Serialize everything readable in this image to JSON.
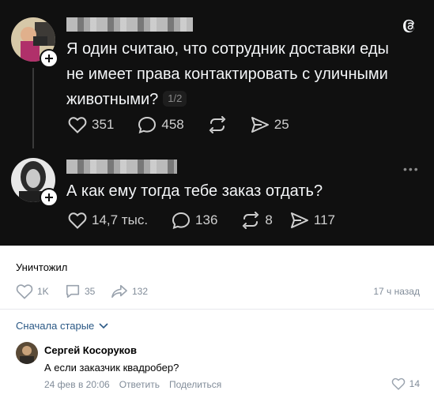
{
  "threads": {
    "post1": {
      "text_line1": "Я один считаю, что сотрудник доставки еды",
      "text_line2": "не имеет права контактировать с уличными",
      "text_line3": "животными?",
      "page": "1/2",
      "likes": "351",
      "comments": "458",
      "shares": "25"
    },
    "post2": {
      "text": "А как ему тогда тебе заказ отдать?",
      "likes": "14,7 тыс.",
      "comments": "136",
      "reposts": "8",
      "shares": "117"
    }
  },
  "vk_post": {
    "caption": "Уничтожил",
    "likes": "1K",
    "comments": "35",
    "shares": "132",
    "time": "17 ч назад"
  },
  "comments_section": {
    "sort_label": "Сначала старые",
    "comment": {
      "author": "Сергей Косоруков",
      "text": "А если заказчик квадробер?",
      "date": "24 фев в 20:06",
      "reply_label": "Ответить",
      "share_label": "Поделиться",
      "likes": "14"
    }
  },
  "colors": {
    "threads_bg": "#101010",
    "vk_link": "#2a5885",
    "vk_muted": "#818c99"
  }
}
